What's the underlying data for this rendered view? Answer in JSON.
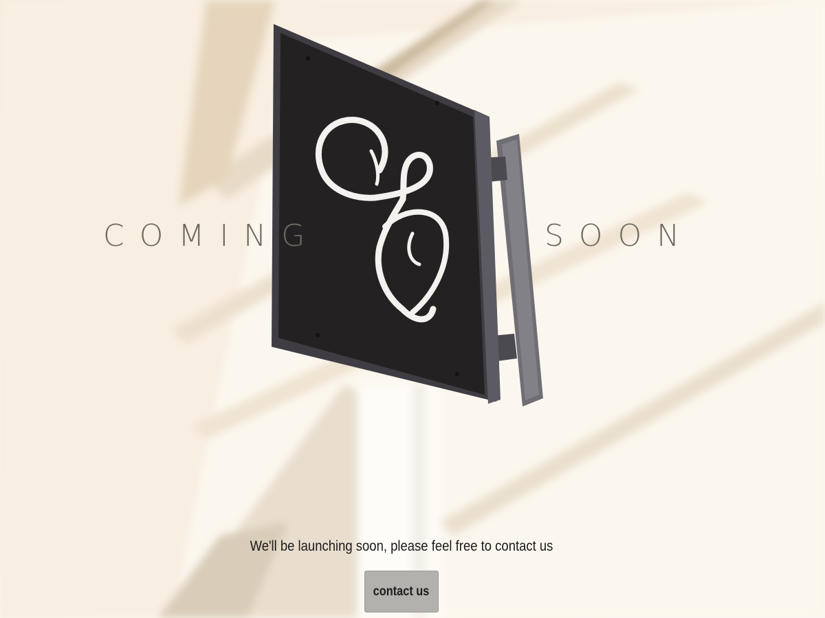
{
  "hero": {
    "word_left": "COMING",
    "word_right": "SOON"
  },
  "message": "We'll be launching soon, please feel free to contact us",
  "contact_button": {
    "label": "contact us"
  },
  "colors": {
    "background": "#fbf4ea",
    "headline": "#6e6a62",
    "sign_panel": "#242122",
    "button": "#b3b1ad"
  },
  "icons": {
    "logo": "script-letter-logo"
  }
}
